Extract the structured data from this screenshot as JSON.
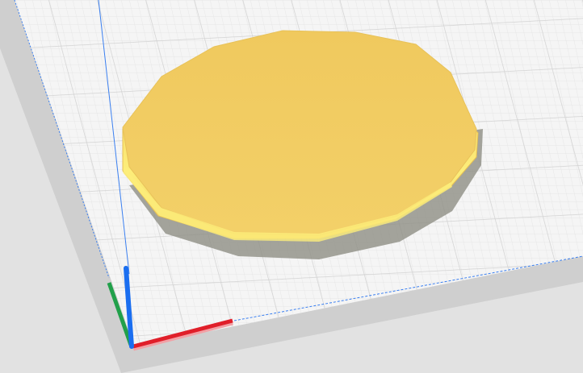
{
  "viewport": {
    "colors": {
      "background": "#d9d9d9",
      "plate": "#f4f4f4",
      "grid_minor": "#e6e6e6",
      "grid_major": "#d2d2d2",
      "boundary": "#3a7ff0",
      "model_top": "#f2cd65",
      "model_side": "#f8dc6a",
      "model_highlight": "#fdee7a",
      "model_shadow": "#8a8a80",
      "axis_x": "#e01f2a",
      "axis_y": "#21a04a",
      "axis_z": "#1a6ef0"
    }
  }
}
